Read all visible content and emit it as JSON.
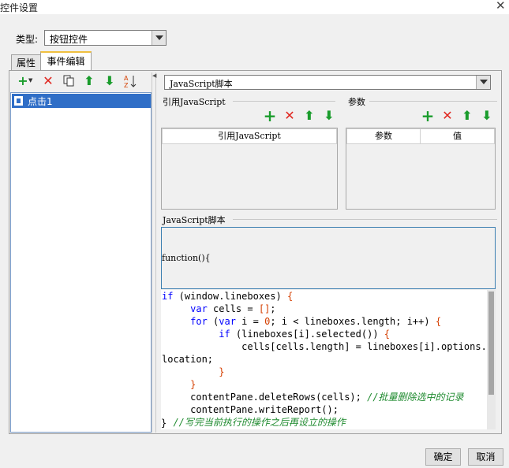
{
  "window": {
    "title": "控件设置",
    "close_glyph": "✕"
  },
  "type_row": {
    "label": "类型:",
    "value": "按钮控件"
  },
  "tabs": [
    {
      "label": "属性"
    },
    {
      "label": "事件编辑"
    }
  ],
  "event_list": {
    "items": [
      {
        "label": "点击1"
      }
    ]
  },
  "left_toolbar": {
    "icons": [
      "add-dropdown-icon",
      "delete-icon",
      "copy-icon",
      "move-up-icon",
      "move-down-icon",
      "sort-icon"
    ]
  },
  "js_type_select": {
    "value": "JavaScript脚本"
  },
  "ref_js": {
    "section_label": "引用JavaScript",
    "column_header": "引用JavaScript"
  },
  "params": {
    "section_label": "参数",
    "columns": [
      "参数",
      "值"
    ]
  },
  "script": {
    "section_label": "JavaScript脚本",
    "header_line": "function(){",
    "closing_line": "}"
  },
  "footer": {
    "ok_label": "确定",
    "cancel_label": "取消"
  },
  "colors": {
    "selection": "#2f6ec7",
    "add_green": "#1a9c2c",
    "delete_red": "#e0261f",
    "keyword_blue": "#0000ff",
    "comment_green": "#1e8a2e"
  }
}
